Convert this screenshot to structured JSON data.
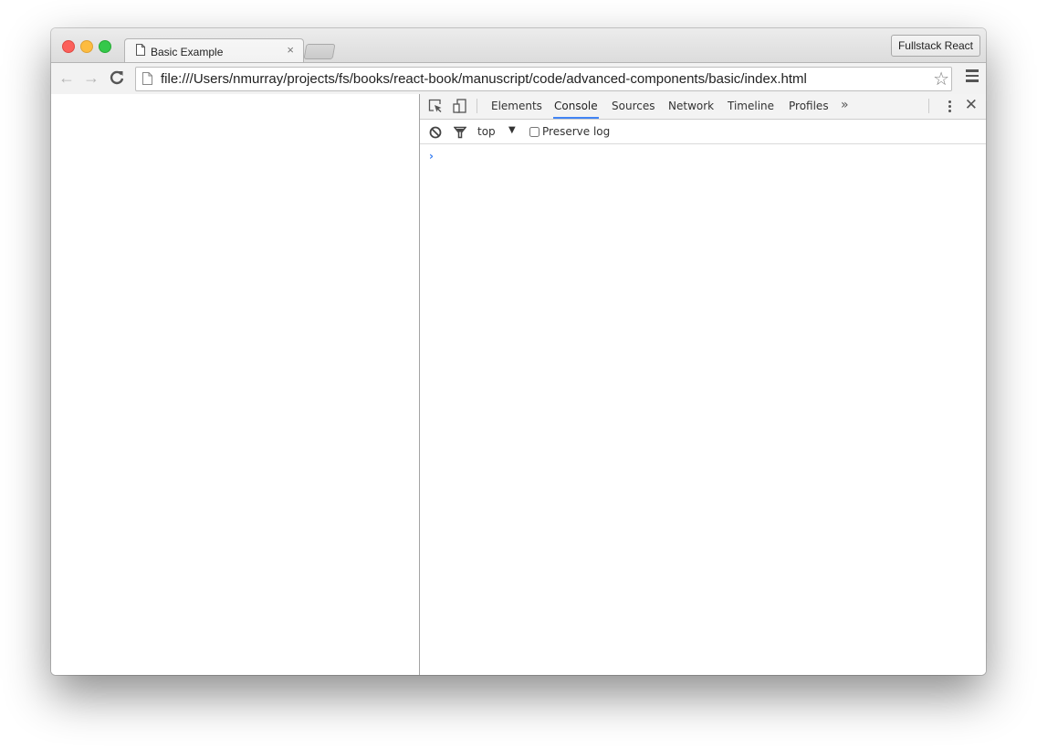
{
  "browser": {
    "tab": {
      "title": "Basic Example",
      "icon": "page-icon",
      "close_glyph": "×"
    },
    "profile_button": "Fullstack React",
    "toolbar": {
      "back_glyph": "←",
      "forward_glyph": "→",
      "reload_glyph": "C",
      "url": "file:///Users/nmurray/projects/fs/books/react-book/manuscript/code/advanced-components/basic/index.html",
      "star_glyph": "☆"
    }
  },
  "devtools": {
    "tabs": [
      {
        "label": "Elements",
        "active": false
      },
      {
        "label": "Console",
        "active": true
      },
      {
        "label": "Sources",
        "active": false
      },
      {
        "label": "Network",
        "active": false
      },
      {
        "label": "Timeline",
        "active": false
      },
      {
        "label": "Profiles",
        "active": false
      }
    ],
    "more_tabs_glyph": "»",
    "close_glyph": "✕",
    "console": {
      "context": "top",
      "context_arrow": "▼",
      "preserve_log_label": "Preserve log",
      "preserve_log_checked": false,
      "prompt_glyph": "›"
    },
    "accent_color": "#4285f4"
  }
}
